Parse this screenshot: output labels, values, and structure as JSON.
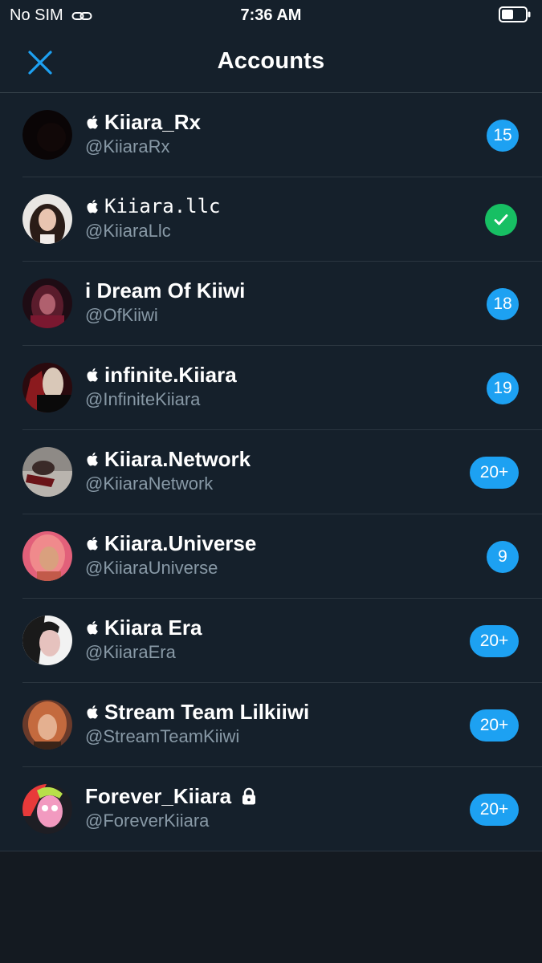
{
  "status_bar": {
    "carrier": "No SIM",
    "time": "7:36 AM"
  },
  "header": {
    "title": "Accounts"
  },
  "colors": {
    "accent": "#1da1f2",
    "verified_green": "#17bf63",
    "background": "#15202b",
    "secondary_text": "#8899a6"
  },
  "accounts": [
    {
      "name": "Kiiara_Rx",
      "handle": "@KiiaraRx",
      "badge": "15",
      "apple_icon": true
    },
    {
      "name": "Kiiara.llc",
      "handle": "@KiiaraLlc",
      "badge": "check",
      "apple_icon": true
    },
    {
      "name": "i Dream Of Kiiwi",
      "handle": "@OfKiiwi",
      "badge": "18",
      "apple_icon": false
    },
    {
      "name": "infinite.Kiiara",
      "handle": "@InfiniteKiiara",
      "badge": "19",
      "apple_icon": true
    },
    {
      "name": "Kiiara.Network",
      "handle": "@KiiaraNetwork",
      "badge": "20+",
      "apple_icon": true
    },
    {
      "name": "Kiiara.Universe",
      "handle": "@KiiaraUniverse",
      "badge": "9",
      "apple_icon": true
    },
    {
      "name": "Kiiara Era",
      "handle": "@KiiaraEra",
      "badge": "20+",
      "apple_icon": true
    },
    {
      "name": "Stream Team Lilkiiwi",
      "handle": "@StreamTeamKiiwi",
      "badge": "20+",
      "apple_icon": true
    },
    {
      "name": "Forever_Kiiara",
      "handle": "@ForeverKiiara",
      "badge": "20+",
      "apple_icon": false,
      "lock_icon": true
    }
  ]
}
